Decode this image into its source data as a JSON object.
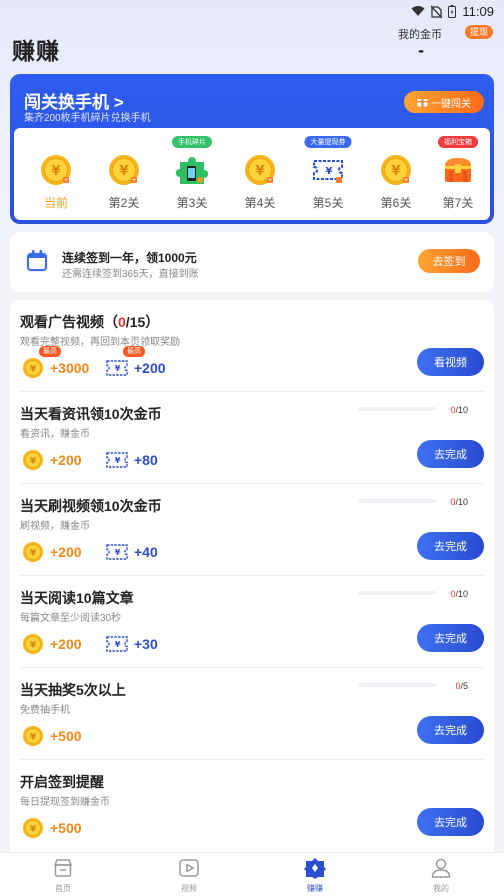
{
  "status_bar": {
    "time": "11:09"
  },
  "header": {
    "title": "赚赚",
    "coins_label": "我的金币",
    "withdraw_label": "提现",
    "coins_value": "-"
  },
  "challenge": {
    "title": "闯关换手机",
    "chevron": ">",
    "subtitle": "集齐200枚手机碎片兑换手机",
    "one_click_label": "一键闯关",
    "levels": [
      {
        "label": "当前",
        "icon": "coin-icon",
        "tag": ""
      },
      {
        "label": "第2关",
        "icon": "coin-icon",
        "tag": ""
      },
      {
        "label": "第3关",
        "icon": "phone-puzzle-icon",
        "tag": "手机碎片"
      },
      {
        "label": "第4关",
        "icon": "coin-icon",
        "tag": ""
      },
      {
        "label": "第5关",
        "icon": "ticket-icon",
        "tag": "大量提现券"
      },
      {
        "label": "第6关",
        "icon": "coin-icon",
        "tag": ""
      },
      {
        "label": "第7关",
        "icon": "treasure-chest-icon",
        "tag": "福利宝箱"
      }
    ],
    "tag_colors": {
      "手机碎片": "#33c26a",
      "大量提现券": "#3b6af0",
      "福利宝箱": "#f03b3b"
    }
  },
  "signin": {
    "title": "连续签到一年，领1000元",
    "subtitle": "还需连续签到365天，直接到账",
    "button": "去签到"
  },
  "tasks": [
    {
      "title_prefix": "观看广告视频（",
      "title_hl": "0",
      "title_suffix": "/15）",
      "desc": "观看完整视频，再回到本页领取奖励",
      "coin_reward": "+3000",
      "ticket_reward": "+200",
      "max_tag": "最高",
      "button": "看视频",
      "progress": null
    },
    {
      "title": "当天看资讯领10次金币",
      "desc": "看资讯，赚金币",
      "coin_reward": "+200",
      "ticket_reward": "+80",
      "button": "去完成",
      "progress": {
        "done": "0",
        "total": "/10",
        "fraction": 0
      }
    },
    {
      "title": "当天刷视频领10次金币",
      "desc": "刷视频，赚金币",
      "coin_reward": "+200",
      "ticket_reward": "+40",
      "button": "去完成",
      "progress": {
        "done": "0",
        "total": "/10",
        "fraction": 0
      }
    },
    {
      "title": "当天阅读10篇文章",
      "desc": "每篇文章至少阅读30秒",
      "coin_reward": "+200",
      "ticket_reward": "+30",
      "button": "去完成",
      "progress": {
        "done": "0",
        "total": "/10",
        "fraction": 0
      }
    },
    {
      "title": "当天抽奖5次以上",
      "desc": "免费抽手机",
      "coin_reward": "+500",
      "ticket_reward": "",
      "button": "去完成",
      "progress": {
        "done": "0",
        "total": "/5",
        "fraction": 0
      }
    },
    {
      "title": "开启签到提醒",
      "desc": "每日提现签到赚金币",
      "coin_reward": "+500",
      "ticket_reward": "",
      "button": "去完成",
      "progress": null
    }
  ],
  "bottom_nav": [
    {
      "label": "首页",
      "icon": "home-shop-icon",
      "active": false
    },
    {
      "label": "视频",
      "icon": "video-play-icon",
      "active": false
    },
    {
      "label": "赚赚",
      "icon": "earn-icon",
      "active": true
    },
    {
      "label": "我的",
      "icon": "profile-icon",
      "active": false
    }
  ],
  "colors": {
    "primary_blue": "#2c4fd8",
    "accent_orange": "#ff7a2a",
    "coin_gold": "#f5b51b",
    "highlight_red": "#e53935"
  }
}
